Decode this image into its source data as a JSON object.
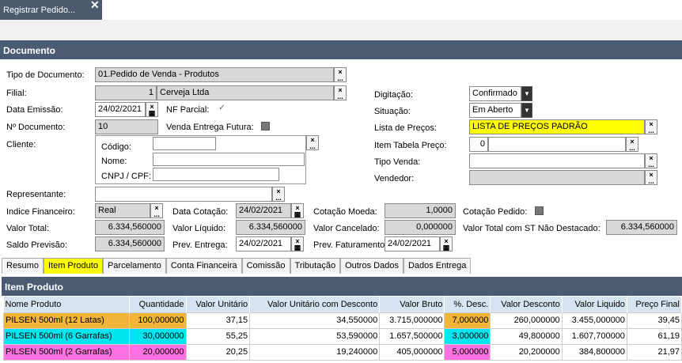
{
  "window_tab": {
    "title": "Registrar Pedido...",
    "close_label": "✕"
  },
  "section_documento": "Documento",
  "form": {
    "tipo_documento": {
      "label": "Tipo de Documento:",
      "value": "01.Pedido de Venda - Produtos"
    },
    "filial": {
      "label": "Filial:",
      "code": "1",
      "name": "Cerveja Ltda"
    },
    "data_emissao": {
      "label": "Data Emissão:",
      "value": "24/02/2021"
    },
    "nf_parcial": {
      "label": "NF Parcial:",
      "checked": "✓"
    },
    "numero_documento": {
      "label": "Nº Documento:",
      "value": "10"
    },
    "venda_entrega_futura": {
      "label": "Venda Entrega Futura:"
    },
    "cliente": {
      "label": "Cliente:",
      "codigo_label": "Código:",
      "nome_label": "Nome:",
      "cnpj_label": "CNPJ / CPF:"
    },
    "representante": {
      "label": "Representante:"
    },
    "indice_financeiro": {
      "label": "Indice Financeiro:",
      "value": "Real"
    },
    "data_cotacao": {
      "label": "Data Cotação:",
      "value": "24/02/2021"
    },
    "cotacao_moeda": {
      "label": "Cotação Moeda:",
      "value": "1,0000"
    },
    "cotacao_pedido": {
      "label": "Cotação Pedido:"
    },
    "valor_total": {
      "label": "Valor Total:",
      "value": "6.334,560000"
    },
    "valor_liquido": {
      "label": "Valor Líquido:",
      "value": "6.334,560000"
    },
    "valor_cancelado": {
      "label": "Valor Cancelado:",
      "value": "0,000000"
    },
    "valor_total_st": {
      "label": "Valor Total com ST Não Destacado:",
      "value": "6.334,560000"
    },
    "saldo_previsao": {
      "label": "Saldo Previsão:",
      "value": "6.334,560000"
    },
    "prev_entrega": {
      "label": "Prev. Entrega:",
      "value": "24/02/2021"
    },
    "prev_faturamento": {
      "label": "Prev. Faturamento:",
      "value": "24/02/2021"
    },
    "digitacao": {
      "label": "Digitação:",
      "value": "Confirmado"
    },
    "situacao": {
      "label": "Situação:",
      "value": "Em Aberto"
    },
    "lista_precos": {
      "label": "Lista de Preços:",
      "value": "LISTA DE PREÇOS PADRÃO"
    },
    "item_tabela_preco": {
      "label": "Item Tabela Preço:",
      "value": "0"
    },
    "tipo_venda": {
      "label": "Tipo Venda:"
    },
    "vendedor": {
      "label": "Vendedor:"
    }
  },
  "tabs": [
    "Resumo",
    "Item Produto",
    "Parcelamento",
    "Conta Financeira",
    "Comissão",
    "Tributação",
    "Outros Dados",
    "Dados Entrega"
  ],
  "section_item_produto": "Item Produto",
  "grid": {
    "headers": [
      "Nome Produto",
      "Quantidade",
      "Valor Unitário",
      "Valor Unitário com Desconto",
      "Valor Bruto",
      "%. Desc.",
      "Valor Desconto",
      "Valor Liquido",
      "Preço Final"
    ],
    "rows": [
      [
        "PILSEN 500ml (12 Latas)",
        "100,000000",
        "37,15",
        "34,550000",
        "3.715,000000",
        "7,000000",
        "260,000000",
        "3.455,000000",
        "39,45"
      ],
      [
        "PILSEN 500ml (6 Garrafas)",
        "30,000000",
        "55,25",
        "53,590000",
        "1.657,500000",
        "3,000000",
        "49,800000",
        "1.607,700000",
        "61,19"
      ],
      [
        "PILSEN 500ml (2 Garrafas)",
        "20,000000",
        "20,25",
        "19,240000",
        "405,000000",
        "5,000000",
        "20,200000",
        "384,800000",
        "21,97"
      ]
    ]
  },
  "colors": {
    "row1_highlight": "#f2b53a",
    "row2_highlight": "#00e5ee",
    "row3_highlight": "#ff70e0",
    "required_field": "#ffff00"
  }
}
